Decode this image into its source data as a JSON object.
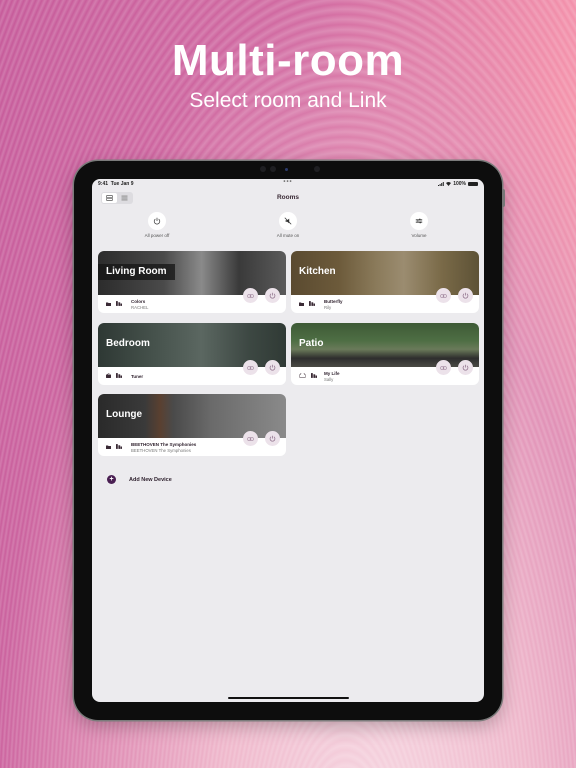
{
  "hero": {
    "title": "Multi-room",
    "subtitle": "Select room and Link"
  },
  "status_bar": {
    "time": "9:41",
    "date": "Tue Jan 9",
    "battery": "100%"
  },
  "header": {
    "title": "Rooms",
    "view_toggle": [
      "card-view-icon",
      "list-view-icon"
    ],
    "active_view": "card-view"
  },
  "quick_actions": [
    {
      "label": "All power off",
      "icon": "power-icon"
    },
    {
      "label": "All mute on",
      "icon": "mute-icon"
    },
    {
      "label": "Volume",
      "icon": "volume-sliders-icon"
    }
  ],
  "rooms": [
    {
      "name": "Living Room",
      "source_icon": "folder-icon",
      "title": "Colors",
      "artist": "RACHEL"
    },
    {
      "name": "Kitchen",
      "source_icon": "folder-icon",
      "title": "Butterfly",
      "artist": "Rily"
    },
    {
      "name": "Bedroom",
      "source_icon": "radio-icon",
      "title": "Tuner",
      "artist": ""
    },
    {
      "name": "Patio",
      "source_icon": "cloud-icon",
      "title": "My Life",
      "artist": "Sally"
    },
    {
      "name": "Lounge",
      "source_icon": "folder-icon",
      "title": "BEETHOVEN The Symphonies",
      "artist": "BEETHOVEN The Symphonies"
    }
  ],
  "add_device": {
    "label": "Add New Device"
  },
  "colors": {
    "accent": "#4a1f52",
    "control_bg": "#ece2ea",
    "screen_bg": "#ecebee"
  }
}
